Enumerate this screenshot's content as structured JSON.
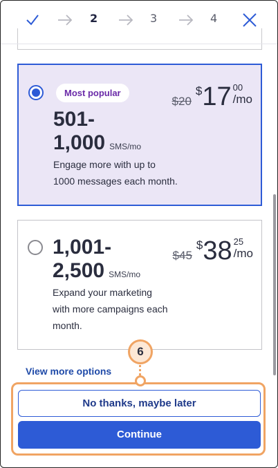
{
  "stepper": {
    "steps": [
      "2",
      "3",
      "4"
    ],
    "active_step": "2"
  },
  "plans": [
    {
      "badge": "Most popular",
      "tier_line1": "501-",
      "tier_line2": "1,000",
      "unit": "SMS/mo",
      "old_price": "$20",
      "currency": "$",
      "price_int": "17",
      "price_cents": "00",
      "per": "/mo",
      "desc_line1": "Engage more with up to",
      "desc_line2": "1000 messages each month.",
      "selected": true
    },
    {
      "tier_line1": "1,001-",
      "tier_line2": "2,500",
      "unit": "SMS/mo",
      "old_price": "$45",
      "currency": "$",
      "price_int": "38",
      "price_cents": "25",
      "per": "/mo",
      "desc_line1": "Expand your marketing",
      "desc_line2": "with more campaigns each",
      "desc_line3": "month.",
      "selected": false
    }
  ],
  "view_more_label": "View more options",
  "callout_number": "6",
  "buttons": {
    "secondary_label": "No thanks, maybe later",
    "primary_label": "Continue"
  },
  "colors": {
    "accent": "#2d5bd6",
    "selected_bg": "#ebe6f6",
    "callout": "#f0a463"
  }
}
